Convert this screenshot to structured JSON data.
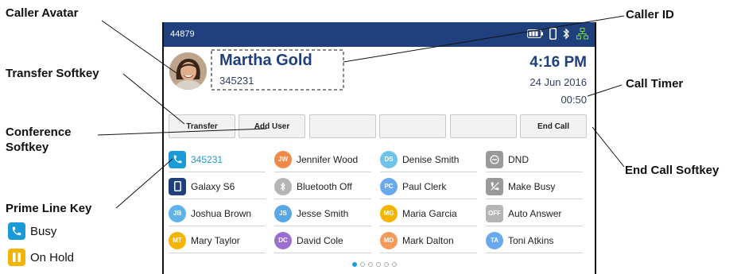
{
  "annotations": {
    "caller_avatar": "Caller Avatar",
    "transfer_softkey": "Transfer Softkey",
    "conference_softkey_line1": "Conference",
    "conference_softkey_line2": "Softkey",
    "prime_line_key": "Prime Line Key",
    "caller_id": "Caller ID",
    "call_timer": "Call Timer",
    "end_call_softkey": "End Call Softkey"
  },
  "legend": [
    {
      "label": "Busy",
      "icon": "phone-handset-icon",
      "color": "#1a9ad6"
    },
    {
      "label": "On Hold",
      "icon": "pause-icon",
      "color": "#f2b400"
    }
  ],
  "status_bar": {
    "extension": "44879",
    "icons": [
      "battery-icon",
      "mobile-phone-icon",
      "bluetooth-icon",
      "network-icon"
    ]
  },
  "call": {
    "caller_name": "Martha Gold",
    "caller_number": "345231",
    "time": "4:16 PM",
    "date": "24 Jun 2016",
    "timer": "00:50"
  },
  "softkeys": [
    "Transfer",
    "Add User",
    "",
    "",
    "",
    "End Call"
  ],
  "line_keys": [
    [
      {
        "label": "345231",
        "badge": "",
        "icon": "phone-handset-icon",
        "color": "#1a9ad6",
        "shape": "square",
        "active": true
      },
      {
        "label": "Galaxy S6",
        "badge": "",
        "icon": "mobile-phone-icon",
        "color": "#1f3f7d",
        "shape": "square"
      },
      {
        "label": "Joshua Brown",
        "badge": "JB",
        "color": "#5fb3e8",
        "shape": "circle"
      },
      {
        "label": "Mary Taylor",
        "badge": "MT",
        "color": "#f5b400",
        "shape": "circle"
      }
    ],
    [
      {
        "label": "Jennifer Wood",
        "badge": "JW",
        "color": "#f08a4b",
        "shape": "circle"
      },
      {
        "label": "Bluetooth Off",
        "badge": "",
        "icon": "bluetooth-icon",
        "color": "#b5b5b5",
        "shape": "circle"
      },
      {
        "label": "Jesse Smith",
        "badge": "JS",
        "color": "#5aa7e6",
        "shape": "circle"
      },
      {
        "label": "David Cole",
        "badge": "DC",
        "color": "#9b6fd1",
        "shape": "circle"
      }
    ],
    [
      {
        "label": "Denise Smith",
        "badge": "DS",
        "color": "#6ec3ec",
        "shape": "circle"
      },
      {
        "label": "Paul Clerk",
        "badge": "PC",
        "color": "#6aa9ee",
        "shape": "circle"
      },
      {
        "label": "Maria Garcia",
        "badge": "MG",
        "color": "#f5b400",
        "shape": "circle"
      },
      {
        "label": "Mark Dalton",
        "badge": "MD",
        "color": "#f59a5b",
        "shape": "circle"
      }
    ],
    [
      {
        "label": "DND",
        "badge": "",
        "icon": "dnd-icon",
        "color": "#9a9a9a",
        "shape": "square"
      },
      {
        "label": "Make Busy",
        "badge": "",
        "icon": "phone-busy-icon",
        "color": "#9a9a9a",
        "shape": "square"
      },
      {
        "label": "Auto Answer",
        "badge": "OFF",
        "color": "#b5b5b5",
        "shape": "square"
      },
      {
        "label": "Toni Atkins",
        "badge": "TA",
        "color": "#6aa9ee",
        "shape": "circle"
      }
    ]
  ],
  "page_indicator": {
    "pages": 6,
    "current": 1
  }
}
